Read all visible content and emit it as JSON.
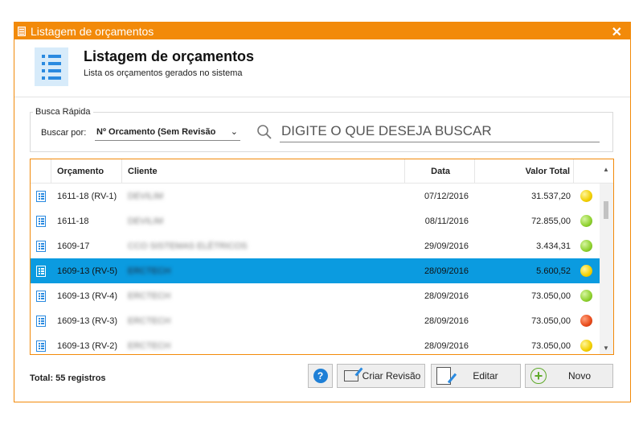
{
  "window": {
    "title": "Listagem de orçamentos",
    "close_glyph": "✕",
    "accent": "#f28a0a"
  },
  "header": {
    "title": "Listagem de orçamentos",
    "subtitle": "Lista os orçamentos gerados no sistema"
  },
  "search": {
    "group_label": "Busca Rápida",
    "by_label": "Buscar por:",
    "by_value": "Nº Orcamento (Sem Revisão",
    "placeholder": "DIGITE O QUE DESEJA BUSCAR"
  },
  "table": {
    "columns": {
      "orcamento": "Orçamento",
      "cliente": "Cliente",
      "data": "Data",
      "valor": "Valor Total"
    },
    "rows": [
      {
        "orcamento": "1611-18 (RV-1)",
        "cliente": "DEVILIM",
        "data": "07/12/2016",
        "valor": "31.537,20",
        "status": "yellow",
        "selected": false
      },
      {
        "orcamento": "1611-18",
        "cliente": "DEVILIM",
        "data": "08/11/2016",
        "valor": "72.855,00",
        "status": "green",
        "selected": false
      },
      {
        "orcamento": "1609-17",
        "cliente": "CCO SISTEMAS ELÉTRICOS",
        "data": "29/09/2016",
        "valor": "3.434,31",
        "status": "green",
        "selected": false
      },
      {
        "orcamento": "1609-13 (RV-5)",
        "cliente": "ERCTECH",
        "data": "28/09/2016",
        "valor": "5.600,52",
        "status": "yellow",
        "selected": true
      },
      {
        "orcamento": "1609-13 (RV-4)",
        "cliente": "ERCTECH",
        "data": "28/09/2016",
        "valor": "73.050,00",
        "status": "green",
        "selected": false
      },
      {
        "orcamento": "1609-13 (RV-3)",
        "cliente": "ERCTECH",
        "data": "28/09/2016",
        "valor": "73.050,00",
        "status": "red",
        "selected": false
      },
      {
        "orcamento": "1609-13 (RV-2)",
        "cliente": "ERCTECH",
        "data": "28/09/2016",
        "valor": "73.050,00",
        "status": "yellow",
        "selected": false
      }
    ]
  },
  "footer": {
    "total": "Total: 55 registros",
    "help_label": "?",
    "create_revision_label": "Criar Revisão",
    "edit_label": "Editar",
    "new_label": "Novo"
  }
}
